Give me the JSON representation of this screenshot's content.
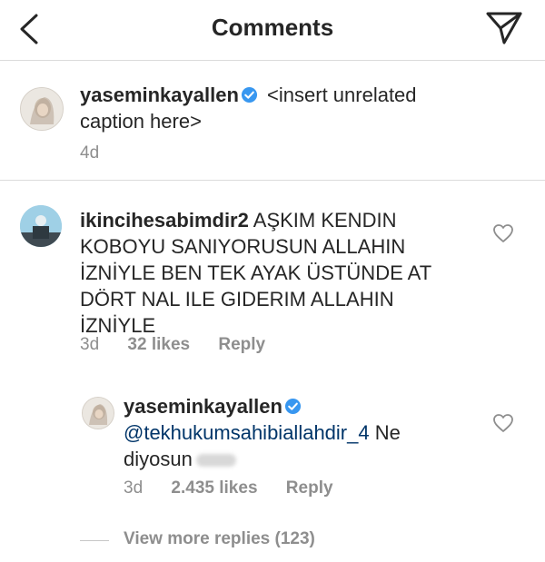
{
  "header": {
    "title": "Comments",
    "back_icon": "chevron-left-icon",
    "send_icon": "paper-plane-icon"
  },
  "caption": {
    "username": "yaseminkayallen",
    "text": "<insert unrelated caption here>",
    "time": "4d"
  },
  "comments": [
    {
      "username": "ikincihesabimdir2",
      "text": "AŞKIM KENDIN KOBOYU SANIYORUSUN ALLAHIN İZNİYLE BEN TEK AYAK ÜSTÜNDE AT DÖRT NAL ILE GIDERIM ALLAHIN İZNİYLE",
      "time": "3d",
      "likes": "32 likes",
      "reply_label": "Reply"
    }
  ],
  "reply": {
    "username": "yaseminkayallen",
    "mention": "@tekhukumsahibiallahdir_4",
    "text": "Ne diyosun",
    "time": "3d",
    "likes": "2.435 likes",
    "reply_label": "Reply"
  },
  "view_more": "View more replies (123)",
  "colors": {
    "verified": "#3897f0",
    "mention": "#003569",
    "meta": "#8e8e8e"
  }
}
